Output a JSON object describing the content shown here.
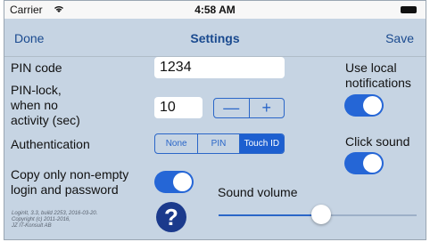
{
  "status_bar": {
    "carrier": "Carrier",
    "time": "4:58 AM"
  },
  "nav": {
    "left": "Done",
    "title": "Settings",
    "right": "Save"
  },
  "pin_code": {
    "label": "PIN code",
    "value": "1234"
  },
  "pin_lock": {
    "label_line1": "PIN-lock,",
    "label_line2": "when no",
    "label_line3": "activity (sec)",
    "value": "10",
    "minus": "—",
    "plus": "+"
  },
  "authentication": {
    "label": "Authentication",
    "options": [
      "None",
      "PIN",
      "Touch ID"
    ],
    "selected": "Touch ID"
  },
  "copy_nonempty": {
    "label_line1": "Copy only non-empty",
    "label_line2": "login and password",
    "on": true
  },
  "local_notifications": {
    "label_line1": "Use local",
    "label_line2": "notifications",
    "on": true
  },
  "click_sound": {
    "label": "Click sound",
    "on": true
  },
  "sound_volume": {
    "label": "Sound volume",
    "level": 0.52
  },
  "about": {
    "line1": "LoginIt, 3.3, build 2253, 2016-03-20.",
    "line2": "Copyright (c) 2011-2016,",
    "line3": "JZ IT-Konsult AB"
  },
  "help": {
    "glyph": "?"
  },
  "colors": {
    "background": "#c6d4e3",
    "accent": "#2566d6",
    "nav_text": "#1a4a8f"
  },
  "icons": {
    "wifi": "wifi-icon",
    "battery": "battery-icon",
    "help": "help-icon"
  }
}
